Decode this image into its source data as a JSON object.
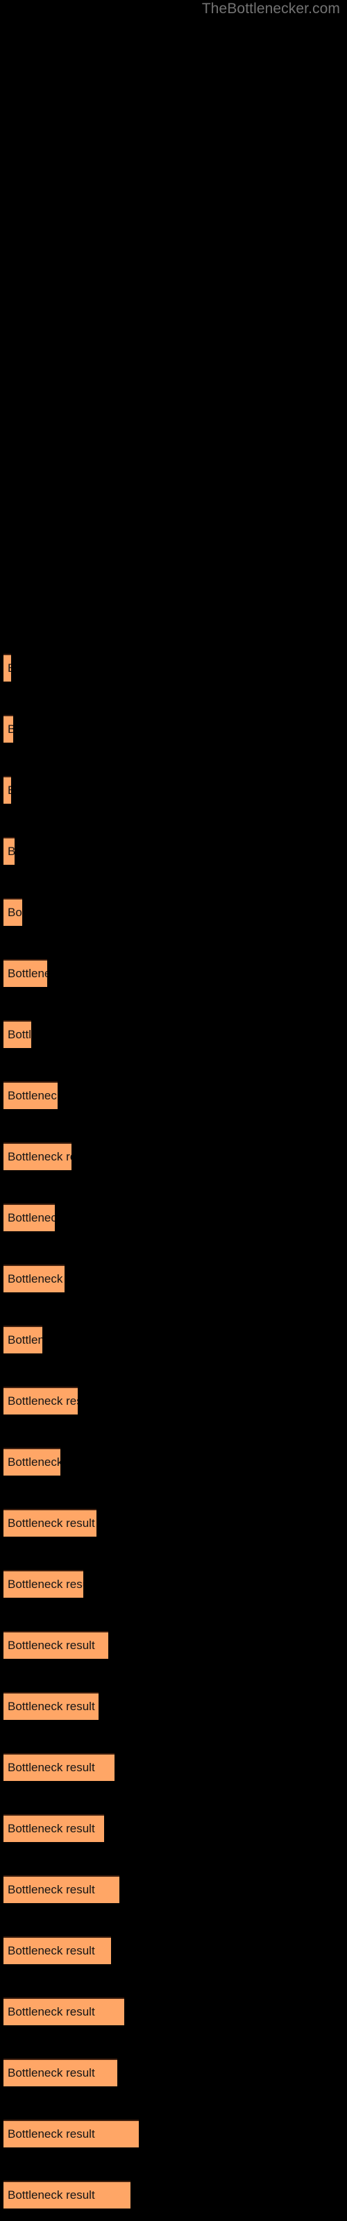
{
  "watermark": {
    "text": "TheBottlenecker.com",
    "color": "#737373"
  },
  "chart": {
    "background": "#000000",
    "bar_color": "#ffa666",
    "bar_border_color": "#40200f",
    "label_color": "#141414",
    "bar_label_text": "Bottleneck result"
  },
  "chart_data": {
    "type": "bar",
    "orientation": "horizontal",
    "title": "",
    "subtitle": "",
    "xlabel": "",
    "ylabel": "",
    "grid": false,
    "legend": null,
    "xlim": [
      0,
      500
    ],
    "categories": [
      "Bottleneck result",
      "Bottleneck result",
      "Bottleneck result",
      "Bottleneck result",
      "Bottleneck result",
      "Bottleneck result",
      "Bottleneck result",
      "Bottleneck result",
      "Bottleneck result",
      "Bottleneck result",
      "Bottleneck result",
      "Bottleneck result",
      "Bottleneck result",
      "Bottleneck result",
      "Bottleneck result",
      "Bottleneck result",
      "Bottleneck result",
      "Bottleneck result",
      "Bottleneck result",
      "Bottleneck result",
      "Bottleneck result",
      "Bottleneck result",
      "Bottleneck result",
      "Bottleneck result",
      "Bottleneck result",
      "Bottleneck result"
    ],
    "values": [
      11,
      14,
      11,
      16,
      27,
      63,
      40,
      78,
      98,
      74,
      88,
      56,
      107,
      82,
      134,
      115,
      151,
      137,
      160,
      145,
      167,
      155,
      174,
      164,
      195,
      183
    ],
    "bars": [
      {
        "y": 942,
        "width": 11,
        "label": ""
      },
      {
        "y": 1030,
        "width": 14,
        "label": "B"
      },
      {
        "y": 1118,
        "width": 11,
        "label": "E"
      },
      {
        "y": 1206,
        "width": 16,
        "label": "B"
      },
      {
        "y": 1294,
        "width": 27,
        "label": "Bottler"
      },
      {
        "y": 1382,
        "width": 63,
        "label": "Bottleneck r"
      },
      {
        "y": 1470,
        "width": 40,
        "label": "Bottlene"
      },
      {
        "y": 1558,
        "width": 78,
        "label": "Bottleneck re"
      },
      {
        "y": 1646,
        "width": 98,
        "label": "Bottleneck resul"
      },
      {
        "y": 1734,
        "width": 74,
        "label": "Bottleneck re"
      },
      {
        "y": 1822,
        "width": 88,
        "label": "Bottleneck res"
      },
      {
        "y": 1910,
        "width": 56,
        "label": "Bottleneck"
      },
      {
        "y": 1998,
        "width": 107,
        "label": "Bottleneck result"
      },
      {
        "y": 2086,
        "width": 82,
        "label": "Bottleneck res"
      },
      {
        "y": 2174,
        "width": 134,
        "label": "Bottleneck result"
      },
      {
        "y": 2262,
        "width": 115,
        "label": "Bottleneck result"
      },
      {
        "y": 2350,
        "width": 151,
        "label": "Bottleneck result"
      },
      {
        "y": 2438,
        "width": 137,
        "label": "Bottleneck result"
      },
      {
        "y": 2526,
        "width": 160,
        "label": "Bottleneck result"
      },
      {
        "y": 2614,
        "width": 145,
        "label": "Bottleneck result"
      },
      {
        "y": 2702,
        "width": 167,
        "label": "Bottleneck result"
      },
      {
        "y": 2790,
        "width": 155,
        "label": "Bottleneck result"
      },
      {
        "y": 2878,
        "width": 174,
        "label": "Bottleneck result"
      },
      {
        "y": 2966,
        "width": 164,
        "label": "Bottleneck result"
      },
      {
        "y": 3054,
        "width": 195,
        "label": "Bottleneck result"
      },
      {
        "y": 3142,
        "width": 183,
        "label": "Bottleneck result"
      }
    ]
  }
}
